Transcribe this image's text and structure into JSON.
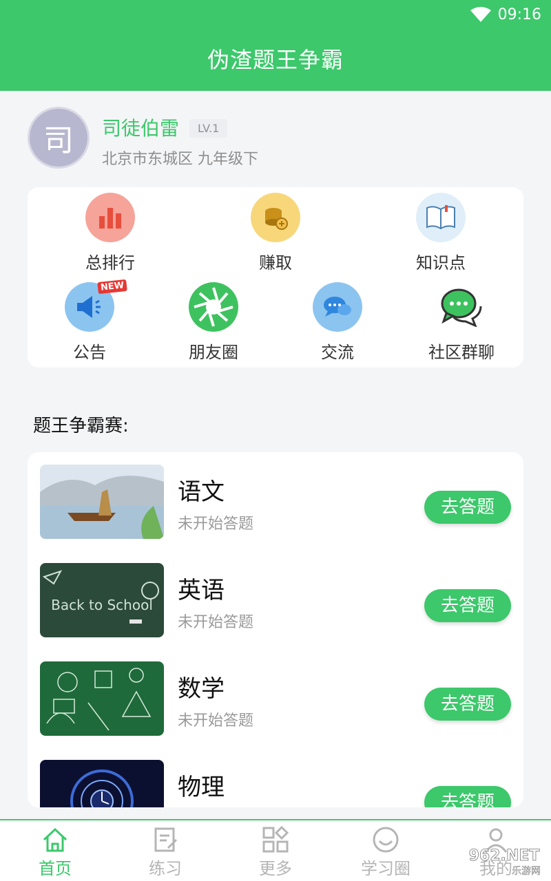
{
  "status_bar": {
    "time": "09:16"
  },
  "header": {
    "title": "伪渣题王争霸"
  },
  "profile": {
    "avatar_char": "司",
    "name": "司徒伯雷",
    "level": "LV.1",
    "location_grade": "北京市东城区 九年级下"
  },
  "menu": {
    "row1": [
      {
        "label": "总排行",
        "icon": "bar-chart-icon"
      },
      {
        "label": "赚取",
        "icon": "coins-icon"
      },
      {
        "label": "知识点",
        "icon": "book-icon"
      }
    ],
    "row2": [
      {
        "label": "公告",
        "icon": "megaphone-icon",
        "badge": "NEW"
      },
      {
        "label": "朋友圈",
        "icon": "aperture-icon"
      },
      {
        "label": "交流",
        "icon": "chat-bubbles-icon"
      },
      {
        "label": "社区群聊",
        "icon": "group-chat-icon"
      }
    ]
  },
  "section": {
    "title": "题王争霸赛:"
  },
  "subjects": [
    {
      "name": "语文",
      "status": "未开始答题",
      "button": "去答题"
    },
    {
      "name": "英语",
      "status": "未开始答题",
      "button": "去答题"
    },
    {
      "name": "数学",
      "status": "未开始答题",
      "button": "去答题"
    },
    {
      "name": "物理",
      "status": "",
      "button": "去答题"
    }
  ],
  "thumb_text": {
    "english_board": "Back to School"
  },
  "tabs": [
    {
      "label": "首页",
      "icon": "home-icon",
      "active": true
    },
    {
      "label": "练习",
      "icon": "edit-icon",
      "active": false
    },
    {
      "label": "更多",
      "icon": "grid-icon",
      "active": false
    },
    {
      "label": "学习圈",
      "icon": "smile-icon",
      "active": false
    },
    {
      "label": "我的",
      "icon": "user-icon",
      "active": false
    }
  ],
  "watermark": {
    "text": "962.NET",
    "sub": "乐游网"
  },
  "colors": {
    "brand": "#3cc86b",
    "avatar": "#b7b7cf"
  }
}
